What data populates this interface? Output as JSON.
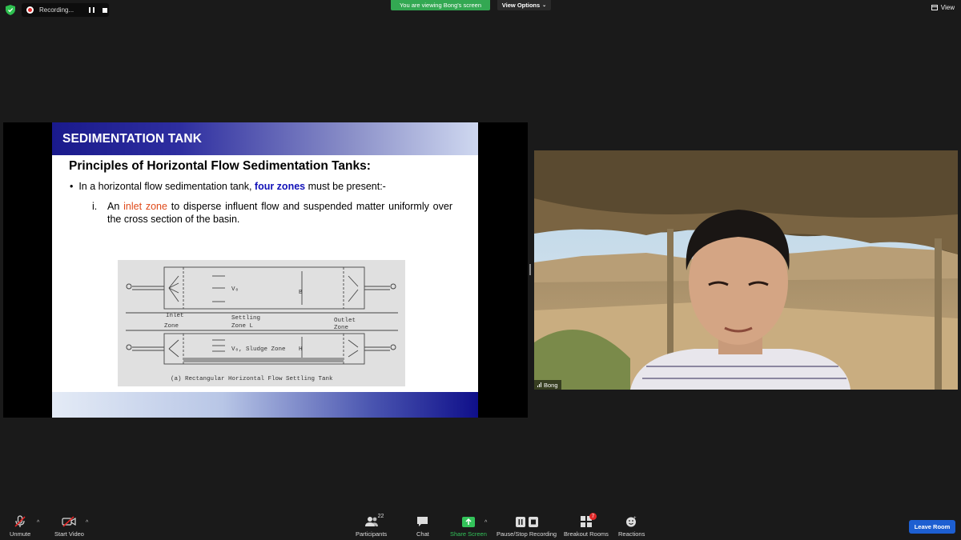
{
  "top_bar": {
    "recording_label": "Recording...",
    "viewing_banner": "You are viewing Bong's screen",
    "view_options": "View Options",
    "view_label": "View"
  },
  "slide": {
    "header_title": "SEDIMENTATION TANK",
    "heading": "Principles of Horizontal Flow Sedimentation Tanks:",
    "bullet_prefix": "In a horizontal flow sedimentation tank, ",
    "bullet_highlight": "four zones",
    "bullet_suffix": " must be present:-",
    "sub_number": "i.",
    "sub_prefix": "An ",
    "sub_highlight": "inlet zone",
    "sub_suffix": " to disperse influent flow and suspended matter uniformly over the cross section of the basin.",
    "diagram": {
      "inlet_zone": "Inlet",
      "inlet_zone_2": "Zone",
      "settling_zone": "Settling",
      "settling_zone_2": "Zone L",
      "outlet_zone": "Outlet",
      "outlet_zone_2": "Zone",
      "vo_top": "V₀",
      "b_label": "B",
      "vo_sludge": "V₀, Sludge Zone",
      "h_label": "H",
      "caption": "(a) Rectangular Horizontal Flow Settling Tank"
    }
  },
  "video": {
    "participant_name": "Bong"
  },
  "toolbar": {
    "unmute": "Unmute",
    "start_video": "Start Video",
    "participants": "Participants",
    "participants_count": "22",
    "chat": "Chat",
    "share_screen": "Share Screen",
    "pause_stop_recording": "Pause/Stop Recording",
    "breakout_rooms": "Breakout Rooms",
    "breakout_badge": "7",
    "reactions": "Reactions",
    "leave_room": "Leave Room"
  },
  "colors": {
    "share_green": "#33a852",
    "leave_blue": "#1d5fd1",
    "highlight_blue": "#1111b8",
    "highlight_orange": "#e04a1a"
  }
}
